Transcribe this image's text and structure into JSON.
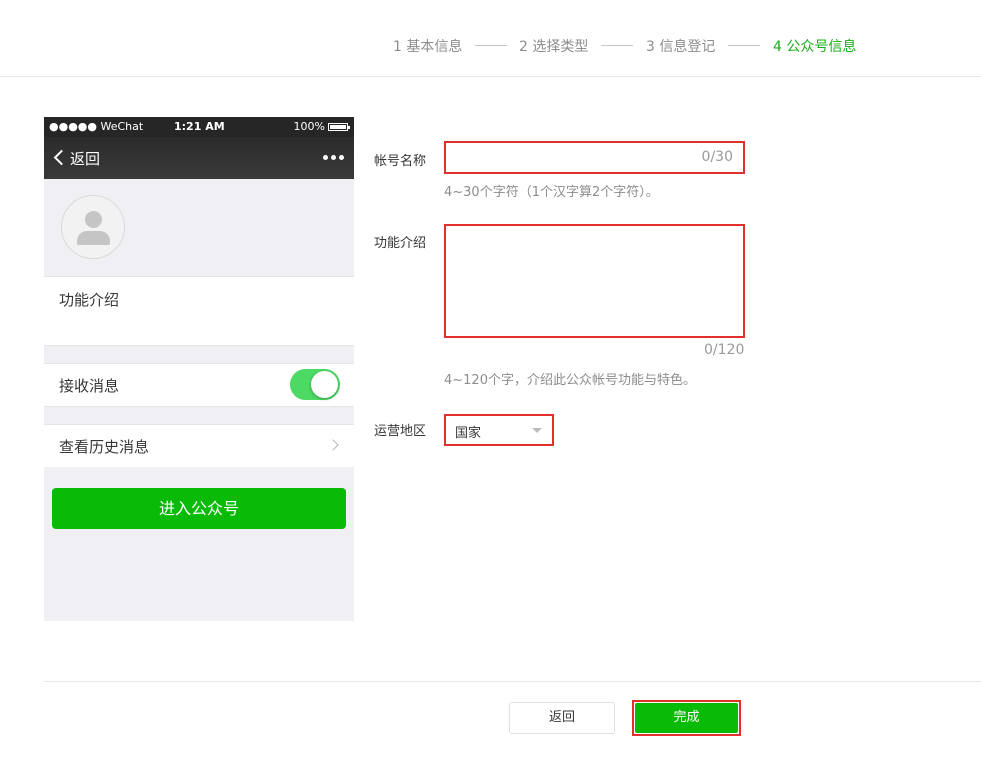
{
  "steps": [
    {
      "label": "1 基本信息",
      "active": false
    },
    {
      "label": "2 选择类型",
      "active": false
    },
    {
      "label": "3 信息登记",
      "active": false
    },
    {
      "label": "4 公众号信息",
      "active": true
    }
  ],
  "phone": {
    "statusbar": {
      "carrier": "●●●●● WeChat",
      "time": "1:21 AM",
      "battery": "100%"
    },
    "navbar": {
      "back_label": "返回"
    },
    "intro_label": "功能介绍",
    "receive_label": "接收消息",
    "receive_enabled": true,
    "history_label": "查看历史消息",
    "enter_button": "进入公众号"
  },
  "form": {
    "name_label": "帐号名称",
    "name_value": "",
    "name_counter": "0/30",
    "name_hint": "4~30个字符（1个汉字算2个字符）。",
    "intro_label": "功能介绍",
    "intro_value": "",
    "intro_counter": "0/120",
    "intro_hint": "4~120个字，介绍此公众帐号功能与特色。",
    "region_label": "运营地区",
    "region_value": "国家"
  },
  "footer": {
    "back_label": "返回",
    "done_label": "完成"
  },
  "colors": {
    "accent": "#1aad19",
    "button_green": "#09bb07",
    "highlight_red": "#e0322b"
  }
}
